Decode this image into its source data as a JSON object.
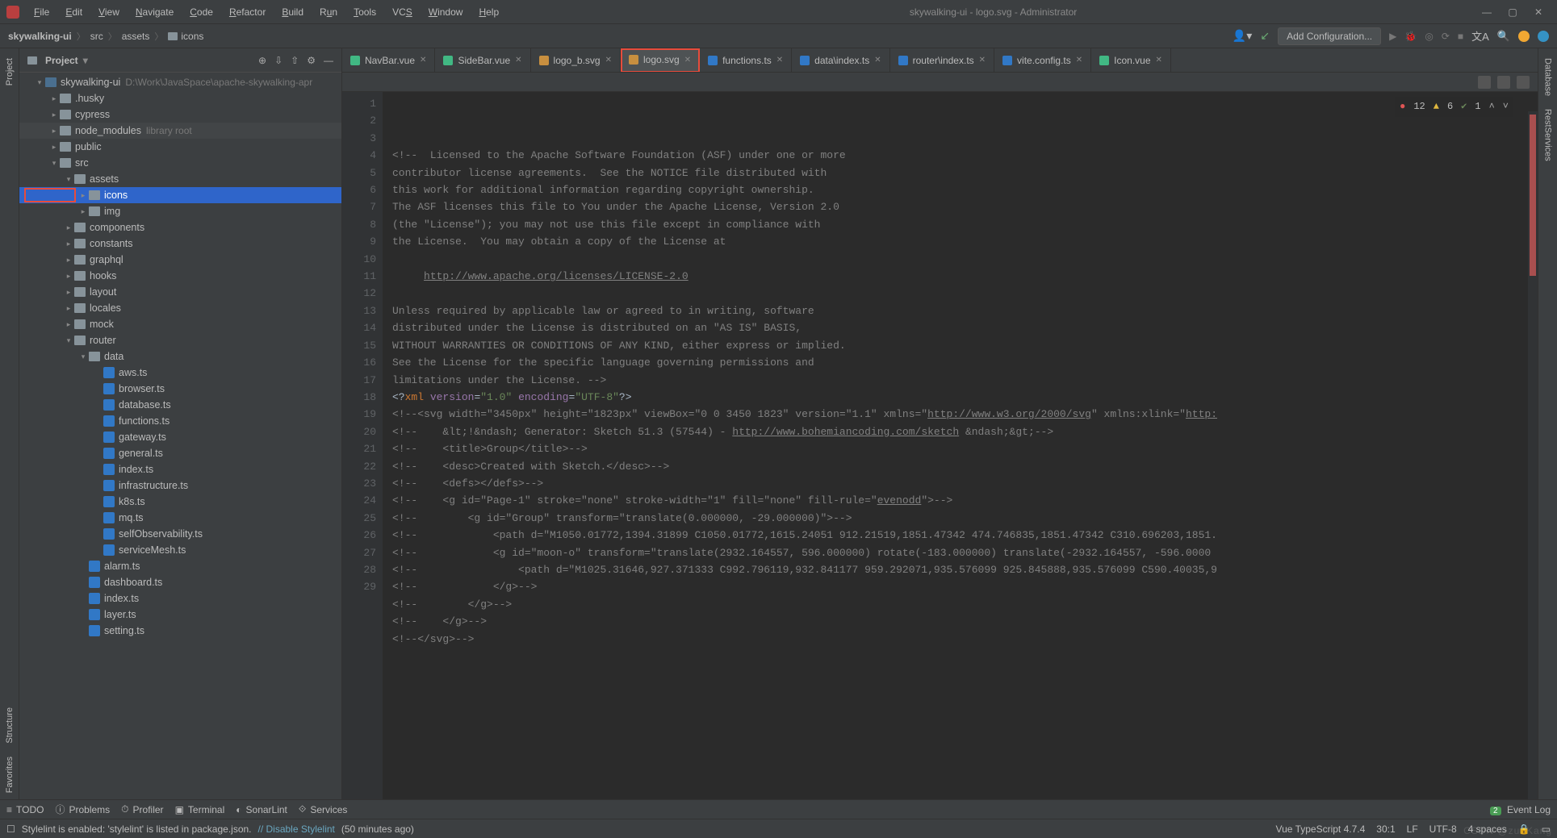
{
  "window": {
    "title": "skywalking-ui - logo.svg - Administrator"
  },
  "menu": [
    {
      "label": "File",
      "u": 0
    },
    {
      "label": "Edit",
      "u": 0
    },
    {
      "label": "View",
      "u": 0
    },
    {
      "label": "Navigate",
      "u": 0
    },
    {
      "label": "Code",
      "u": 0
    },
    {
      "label": "Refactor",
      "u": 0
    },
    {
      "label": "Build",
      "u": 0
    },
    {
      "label": "Run",
      "u": 1
    },
    {
      "label": "Tools",
      "u": 0
    },
    {
      "label": "VCS",
      "u": 2
    },
    {
      "label": "Window",
      "u": 0
    },
    {
      "label": "Help",
      "u": 0
    }
  ],
  "breadcrumbs": [
    "skywalking-ui",
    "src",
    "assets",
    "icons"
  ],
  "run_config": "Add Configuration...",
  "nav_actions": {
    "run": "▶",
    "debug": "🐞",
    "coverage": "◎",
    "profile": "⟳",
    "stop": "■"
  },
  "sidebar": {
    "title": "Project",
    "actions": [
      "⊕",
      "⇩",
      "⇧",
      "⚙",
      "—"
    ]
  },
  "tree": [
    {
      "indent": 0,
      "arrow": "open",
      "icon": "module",
      "label": "skywalking-ui",
      "hint": "D:\\Work\\JavaSpace\\apache-skywalking-apr"
    },
    {
      "indent": 1,
      "arrow": "closed",
      "icon": "folder",
      "label": ".husky"
    },
    {
      "indent": 1,
      "arrow": "closed",
      "icon": "folder",
      "label": "cypress"
    },
    {
      "indent": 1,
      "arrow": "closed",
      "icon": "folder",
      "label": "node_modules",
      "hint": "library root",
      "shade": true
    },
    {
      "indent": 1,
      "arrow": "closed",
      "icon": "folder",
      "label": "public"
    },
    {
      "indent": 1,
      "arrow": "open",
      "icon": "folder",
      "label": "src"
    },
    {
      "indent": 2,
      "arrow": "open",
      "icon": "folder",
      "label": "assets"
    },
    {
      "indent": 3,
      "arrow": "closed",
      "icon": "folder",
      "label": "icons",
      "selected": true,
      "highlighted": true
    },
    {
      "indent": 3,
      "arrow": "closed",
      "icon": "folder",
      "label": "img"
    },
    {
      "indent": 2,
      "arrow": "closed",
      "icon": "folder",
      "label": "components"
    },
    {
      "indent": 2,
      "arrow": "closed",
      "icon": "folder",
      "label": "constants"
    },
    {
      "indent": 2,
      "arrow": "closed",
      "icon": "folder",
      "label": "graphql"
    },
    {
      "indent": 2,
      "arrow": "closed",
      "icon": "folder",
      "label": "hooks"
    },
    {
      "indent": 2,
      "arrow": "closed",
      "icon": "folder",
      "label": "layout"
    },
    {
      "indent": 2,
      "arrow": "closed",
      "icon": "folder",
      "label": "locales"
    },
    {
      "indent": 2,
      "arrow": "closed",
      "icon": "folder",
      "label": "mock"
    },
    {
      "indent": 2,
      "arrow": "open",
      "icon": "folder",
      "label": "router"
    },
    {
      "indent": 3,
      "arrow": "open",
      "icon": "folder",
      "label": "data"
    },
    {
      "indent": 4,
      "arrow": "none",
      "icon": "ts",
      "label": "aws.ts"
    },
    {
      "indent": 4,
      "arrow": "none",
      "icon": "ts",
      "label": "browser.ts"
    },
    {
      "indent": 4,
      "arrow": "none",
      "icon": "ts",
      "label": "database.ts"
    },
    {
      "indent": 4,
      "arrow": "none",
      "icon": "ts",
      "label": "functions.ts"
    },
    {
      "indent": 4,
      "arrow": "none",
      "icon": "ts",
      "label": "gateway.ts"
    },
    {
      "indent": 4,
      "arrow": "none",
      "icon": "ts",
      "label": "general.ts"
    },
    {
      "indent": 4,
      "arrow": "none",
      "icon": "ts",
      "label": "index.ts"
    },
    {
      "indent": 4,
      "arrow": "none",
      "icon": "ts",
      "label": "infrastructure.ts"
    },
    {
      "indent": 4,
      "arrow": "none",
      "icon": "ts",
      "label": "k8s.ts"
    },
    {
      "indent": 4,
      "arrow": "none",
      "icon": "ts",
      "label": "mq.ts"
    },
    {
      "indent": 4,
      "arrow": "none",
      "icon": "ts",
      "label": "selfObservability.ts"
    },
    {
      "indent": 4,
      "arrow": "none",
      "icon": "ts",
      "label": "serviceMesh.ts"
    },
    {
      "indent": 3,
      "arrow": "none",
      "icon": "ts",
      "label": "alarm.ts"
    },
    {
      "indent": 3,
      "arrow": "none",
      "icon": "ts",
      "label": "dashboard.ts"
    },
    {
      "indent": 3,
      "arrow": "none",
      "icon": "ts",
      "label": "index.ts"
    },
    {
      "indent": 3,
      "arrow": "none",
      "icon": "ts",
      "label": "layer.ts"
    },
    {
      "indent": 3,
      "arrow": "none",
      "icon": "ts",
      "label": "setting.ts"
    }
  ],
  "tabs": [
    {
      "label": "NavBar.vue",
      "icon": "vue"
    },
    {
      "label": "SideBar.vue",
      "icon": "vue"
    },
    {
      "label": "logo_b.svg",
      "icon": "svg"
    },
    {
      "label": "logo.svg",
      "icon": "svg",
      "active": true,
      "highlighted": true
    },
    {
      "label": "functions.ts",
      "icon": "ts"
    },
    {
      "label": "data\\index.ts",
      "icon": "ts"
    },
    {
      "label": "router\\index.ts",
      "icon": "ts"
    },
    {
      "label": "vite.config.ts",
      "icon": "ts"
    },
    {
      "label": "Icon.vue",
      "icon": "vue"
    }
  ],
  "inspections": {
    "errors": "12",
    "warnings": "6",
    "weak": "1"
  },
  "code_lines": [
    {
      "n": 1,
      "html": "<span class='c-comment'>&lt;!--  Licensed to the Apache Software Foundation (ASF) under one or more</span>"
    },
    {
      "n": 2,
      "html": "<span class='c-comment'>contributor license agreements.  See the NOTICE file distributed with</span>"
    },
    {
      "n": 3,
      "html": "<span class='c-comment'>this work for additional information regarding copyright ownership.</span>"
    },
    {
      "n": 4,
      "html": "<span class='c-comment'>The ASF licenses this file to You under the Apache License, Version 2.0</span>"
    },
    {
      "n": 5,
      "html": "<span class='c-comment'>(the \"License\"); you may not use this file except in compliance with</span>"
    },
    {
      "n": 6,
      "html": "<span class='c-comment'>the License.  You may obtain a copy of the License at</span>"
    },
    {
      "n": 7,
      "html": ""
    },
    {
      "n": 8,
      "html": "<span class='c-comment'>     </span><span class='c-link'>http://www.apache.org/licenses/LICENSE-2.0</span>"
    },
    {
      "n": 9,
      "html": ""
    },
    {
      "n": 10,
      "html": "<span class='c-comment'>Unless required by applicable law or agreed to in writing, software</span>"
    },
    {
      "n": 11,
      "html": "<span class='c-comment'>distributed under the License is distributed on an \"AS IS\" BASIS,</span>"
    },
    {
      "n": 12,
      "html": "<span class='c-comment'>WITHOUT WARRANTIES OR CONDITIONS OF ANY KIND, either express or implied.</span>"
    },
    {
      "n": 13,
      "html": "<span class='c-comment'>See the License for the specific language governing permissions and</span>"
    },
    {
      "n": 14,
      "html": "<span class='c-comment'>limitations under the License. --&gt;</span>"
    },
    {
      "n": 15,
      "html": "<span class='c-punct'>&lt;?</span><span class='c-xml-tag'>xml</span> <span class='c-xml-attr'>version</span>=<span class='c-string'>\"1.0\"</span> <span class='c-xml-attr'>encoding</span>=<span class='c-string'>\"UTF-8\"</span><span class='c-punct'>?&gt;</span>"
    },
    {
      "n": 16,
      "html": "<span class='c-comment'>&lt;!--&lt;svg width=\"3450px\" height=\"1823px\" viewBox=\"0 0 3450 1823\" version=\"1.1\" xmlns=\"</span><span class='c-link'>http://www.w3.org/2000/svg</span><span class='c-comment'>\" xmlns:xlink=\"</span><span class='c-link'>http:</span>"
    },
    {
      "n": 17,
      "html": "<span class='c-comment'>&lt;!--    &amp;lt;!&amp;ndash; Generator: Sketch 51.3 (57544) - </span><span class='c-link'>http://www.bohemiancoding.com/sketch</span><span class='c-comment'> &amp;ndash;&amp;gt;--&gt;</span>"
    },
    {
      "n": 18,
      "html": "<span class='c-comment'>&lt;!--    &lt;title&gt;Group&lt;/title&gt;--&gt;</span>"
    },
    {
      "n": 19,
      "html": "<span class='c-comment'>&lt;!--    &lt;desc&gt;Created with Sketch.&lt;/desc&gt;--&gt;</span>"
    },
    {
      "n": 20,
      "html": "<span class='c-comment'>&lt;!--    &lt;defs&gt;&lt;/defs&gt;--&gt;</span>"
    },
    {
      "n": 21,
      "html": "<span class='c-comment'>&lt;!--    &lt;g id=\"Page-1\" stroke=\"none\" stroke-width=\"1\" fill=\"none\" fill-rule=\"</span><span class='c-link'>evenodd</span><span class='c-comment'>\"&gt;--&gt;</span>"
    },
    {
      "n": 22,
      "html": "<span class='c-comment'>&lt;!--        &lt;g id=\"Group\" transform=\"translate(0.000000, -29.000000)\"&gt;--&gt;</span>"
    },
    {
      "n": 23,
      "html": "<span class='c-comment'>&lt;!--            &lt;path d=\"M1050.01772,1394.31899 C1050.01772,1615.24051 912.21519,1851.47342 474.746835,1851.47342 C310.696203,1851.</span>"
    },
    {
      "n": 24,
      "html": "<span class='c-comment'>&lt;!--            &lt;g id=\"moon-o\" transform=\"translate(2932.164557, 596.000000) rotate(-183.000000) translate(-2932.164557, -596.0000</span>"
    },
    {
      "n": 25,
      "html": "<span class='c-comment'>&lt;!--                &lt;path d=\"M1025.31646,927.371333 C992.796119,932.841177 959.292071,935.576099 925.845888,935.576099 C590.40035,9</span>"
    },
    {
      "n": 26,
      "html": "<span class='c-comment'>&lt;!--            &lt;/g&gt;--&gt;</span>"
    },
    {
      "n": 27,
      "html": "<span class='c-comment'>&lt;!--        &lt;/g&gt;--&gt;</span>"
    },
    {
      "n": 28,
      "html": "<span class='c-comment'>&lt;!--    &lt;/g&gt;--&gt;</span>"
    },
    {
      "n": 29,
      "html": "<span class='c-comment'>&lt;!--&lt;/svg&gt;--&gt;</span>"
    }
  ],
  "tool_windows": [
    {
      "label": "TODO",
      "icon": "≡"
    },
    {
      "label": "Problems",
      "icon": "ⓘ"
    },
    {
      "label": "Profiler",
      "icon": "⏱"
    },
    {
      "label": "Terminal",
      "icon": "▣"
    },
    {
      "label": "SonarLint",
      "icon": "◐"
    },
    {
      "label": "Services",
      "icon": "⟐"
    }
  ],
  "event_log": {
    "count": "2",
    "label": "Event Log"
  },
  "status": {
    "message": "Stylelint is enabled: 'stylelint' is listed in package.json.",
    "action": "// Disable Stylelint",
    "ago": "(50 minutes ago)",
    "lang": "Vue TypeScript 4.7.4",
    "pos": "30:1",
    "line_ending": "LF",
    "encoding": "UTF-8",
    "indent": "4 spaces"
  },
  "left_gutter": [
    "Project",
    "Structure",
    "Favorites"
  ],
  "right_gutter": [
    "Database",
    "RestServices"
  ],
  "watermark": "CSDN @zuoKang"
}
